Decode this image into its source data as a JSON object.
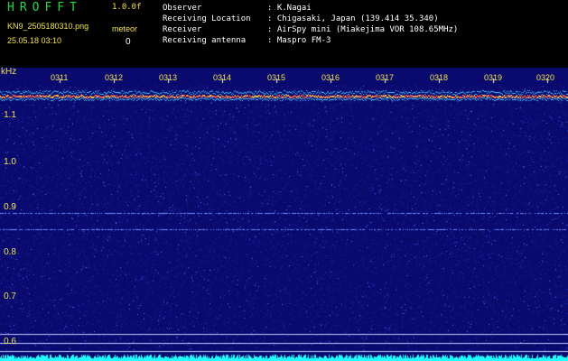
{
  "header": {
    "logo": "HROFFT",
    "version": "1.0.0f",
    "filename": "KN9_2505180310.png",
    "meteor_label": "meteor",
    "meteor_count": "0",
    "timestamp": "25.05.18 03:10"
  },
  "info": [
    {
      "key": "Observer",
      "value": ": K.Nagai"
    },
    {
      "key": "Receiving Location",
      "value": ": Chigasaki, Japan (139.414 35.340)"
    },
    {
      "key": "Receiver",
      "value": ": AirSpy mini (Miakejima VOR 108.65MHz)"
    },
    {
      "key": "Receiving antenna",
      "value": ": Maspro FM-3"
    }
  ],
  "spectrogram": {
    "unit": "kHz",
    "y_ticks": [
      "1.1",
      "1.0",
      "0.9",
      "0.8",
      "0.7",
      "0.6"
    ],
    "x_ticks": [
      "0311",
      "0312",
      "0313",
      "0314",
      "0315",
      "0316",
      "0317",
      "0318",
      "0319",
      "0320"
    ],
    "colors": {
      "background": "#0a0a6e",
      "noise": "#1c2bb0",
      "carrier": "#ffd24a",
      "baseline": "#22ffff",
      "label": "#f2e24a"
    }
  }
}
